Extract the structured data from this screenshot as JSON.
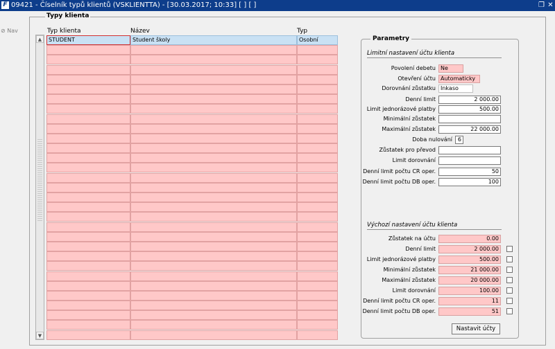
{
  "window": {
    "title": "09421 - Číselník typů klientů (VSKLIENTTA) - [30.03.2017; 10:33]  [ ]  [ ]",
    "icon": "app-logo-icon"
  },
  "nav": {
    "label": "Nav"
  },
  "panel": {
    "title": "Typy klienta",
    "columns": [
      "Typ klienta",
      "Název",
      "Typ"
    ],
    "rows": [
      [
        "STUDENT",
        "Student školy",
        "Osobní"
      ],
      [
        "",
        "",
        ""
      ],
      [
        "",
        "",
        ""
      ],
      [
        "",
        "",
        ""
      ],
      [
        "",
        "",
        ""
      ],
      [
        "",
        "",
        ""
      ],
      [
        "",
        "",
        ""
      ],
      [
        "",
        "",
        ""
      ],
      [
        "",
        "",
        ""
      ],
      [
        "",
        "",
        ""
      ],
      [
        "",
        "",
        ""
      ],
      [
        "",
        "",
        ""
      ],
      [
        "",
        "",
        ""
      ],
      [
        "",
        "",
        ""
      ],
      [
        "",
        "",
        ""
      ],
      [
        "",
        "",
        ""
      ],
      [
        "",
        "",
        ""
      ],
      [
        "",
        "",
        ""
      ],
      [
        "",
        "",
        ""
      ],
      [
        "",
        "",
        ""
      ],
      [
        "",
        "",
        ""
      ],
      [
        "",
        "",
        ""
      ],
      [
        "",
        "",
        ""
      ],
      [
        "",
        "",
        ""
      ],
      [
        "",
        "",
        ""
      ],
      [
        "",
        "",
        ""
      ],
      [
        "",
        "",
        ""
      ],
      [
        "",
        "",
        ""
      ],
      [
        "",
        "",
        ""
      ],
      [
        "",
        "",
        ""
      ],
      [
        "",
        "",
        ""
      ]
    ]
  },
  "parametry": {
    "title": "Parametry",
    "limits": {
      "title": "Limitní nastavení účtu klienta",
      "fields": [
        {
          "label": "Povolení debetu",
          "value": "Ne"
        },
        {
          "label": "Otevření účtu",
          "value": "Automaticky"
        },
        {
          "label": "Dorovnání zůstatku",
          "value": "Inkaso"
        },
        {
          "label": "Denní limit",
          "value": "2 000.00"
        },
        {
          "label": "Limit jednorázové platby",
          "value": "500.00"
        },
        {
          "label": "Minimální zůstatek",
          "value": ""
        },
        {
          "label": "Maximální zůstatek",
          "value": "22 000.00"
        },
        {
          "label": "Doba nulování",
          "value": "6"
        },
        {
          "label": "Zůstatek pro převod",
          "value": ""
        },
        {
          "label": "Limit dorovnání",
          "value": ""
        },
        {
          "label": "Denní limit počtu CR oper.",
          "value": "50"
        },
        {
          "label": "Denní limit počtu DB oper.",
          "value": "100"
        }
      ]
    },
    "defaults": {
      "title": "Výchozí nastavení účtu klienta",
      "fields": [
        {
          "label": "Zůstatek na účtu",
          "value": "0.00"
        },
        {
          "label": "Denní limit",
          "value": "2 000.00"
        },
        {
          "label": "Limit jednorázové platby",
          "value": "500.00"
        },
        {
          "label": "Minimální zůstatek",
          "value": "21 000.00"
        },
        {
          "label": "Maximální zůstatek",
          "value": "20 000.00"
        },
        {
          "label": "Limit dorovnání",
          "value": "100.00"
        },
        {
          "label": "Denní limit počtu CR oper.",
          "value": "11"
        },
        {
          "label": "Denní limit počtu DB oper.",
          "value": "51"
        }
      ]
    },
    "button_label": "Nastavit účty"
  }
}
